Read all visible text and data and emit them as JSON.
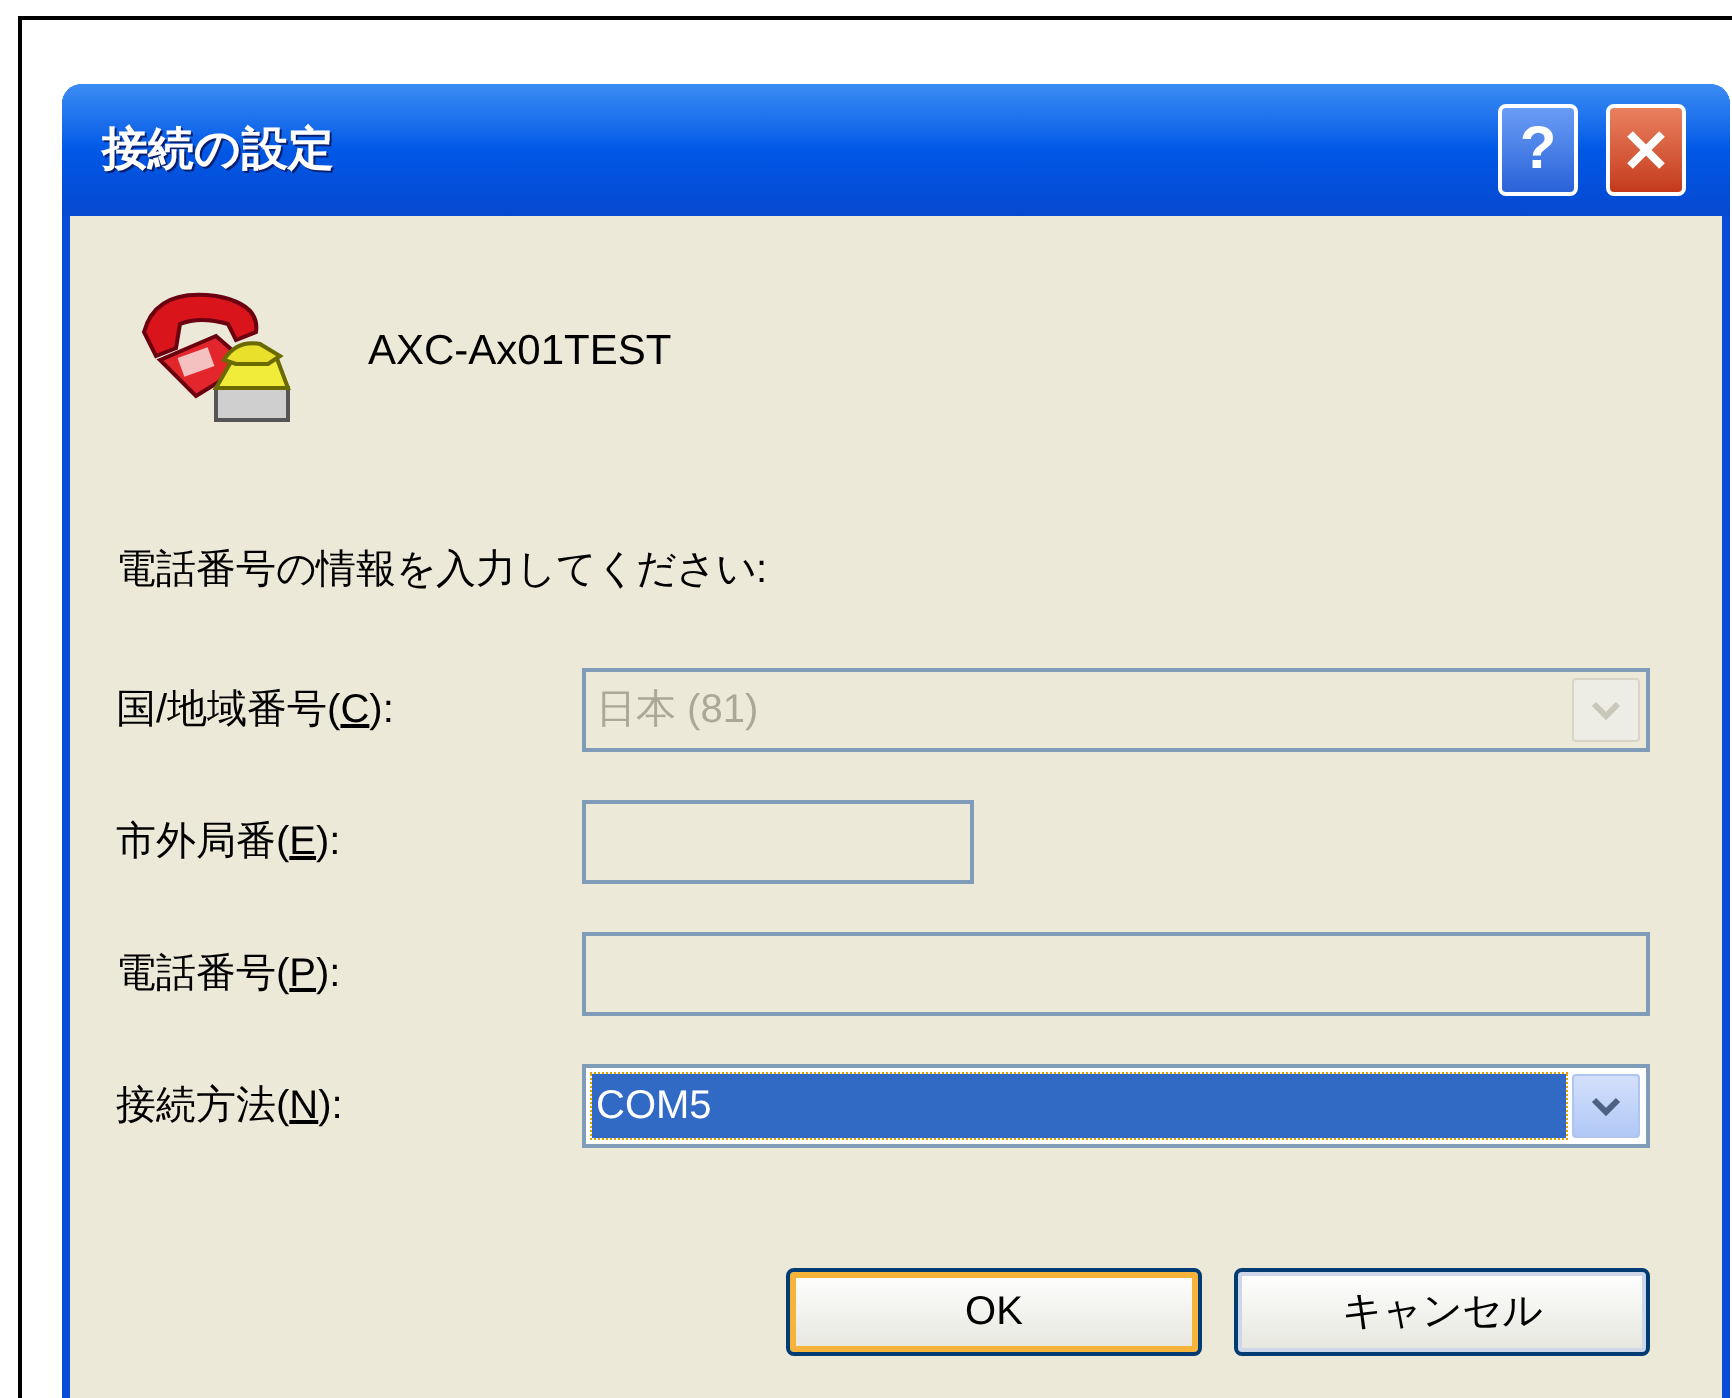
{
  "window": {
    "title": "接続の設定",
    "help_button": "?"
  },
  "connection_name": "AXC-Ax01TEST",
  "instruction": "電話番号の情報を入力してください:",
  "fields": [
    {
      "kind": "combo",
      "label": {
        "before": "国/地域番号(",
        "access_key": "C",
        "after": "):"
      },
      "value": "日本 (81)",
      "disabled": true,
      "focused": false
    },
    {
      "kind": "short_text",
      "label": {
        "before": "市外局番(",
        "access_key": "E",
        "after": "):"
      },
      "disabled": true
    },
    {
      "kind": "text",
      "label": {
        "before": "電話番号(",
        "access_key": "P",
        "after": "):"
      },
      "disabled": true
    },
    {
      "kind": "combo",
      "label": {
        "before": "接続方法(",
        "access_key": "N",
        "after": "):"
      },
      "value": "COM5",
      "disabled": false,
      "focused": true
    }
  ],
  "buttons": [
    {
      "label": "OK",
      "default": true
    },
    {
      "label": "キャンセル",
      "default": false
    }
  ]
}
